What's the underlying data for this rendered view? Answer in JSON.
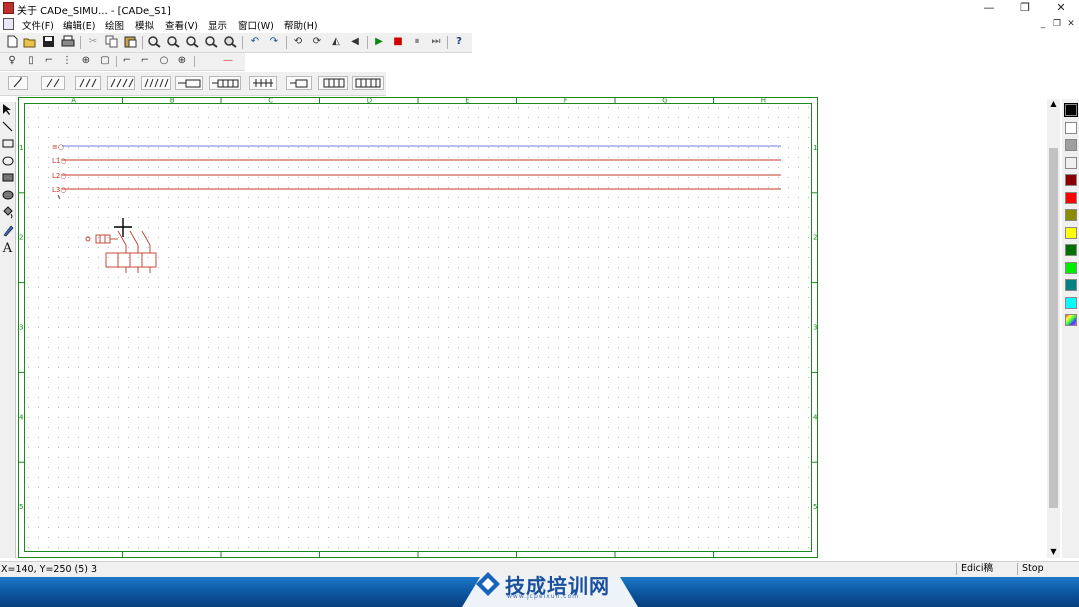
{
  "window": {
    "title": "关于 CADe_SIMU... - [CADe_S1]",
    "minimize_glyph": "—",
    "restore_glyph": "❐",
    "close_glyph": "✕"
  },
  "menu": {
    "items": [
      "文件(F)",
      "编辑(E)",
      "绘图",
      "模拟",
      "查看(V)",
      "显示",
      "窗口(W)",
      "帮助(H)"
    ],
    "mdi_minimize": "_",
    "mdi_restore": "❐",
    "mdi_close": "✕"
  },
  "toolbar_main": {
    "icons": [
      "new-file-icon",
      "open-folder-icon",
      "save-icon",
      "print-icon",
      "cut-icon",
      "copy-icon",
      "paste-icon",
      "zoom-in-icon",
      "zoom-out-icon",
      "zoom-window-icon",
      "zoom-all-icon",
      "pan-icon",
      "undo-icon",
      "redo-icon",
      "rotate-left-icon",
      "rotate-right-icon",
      "mirror-horizontal-icon",
      "mirror-vertical-icon",
      "play-icon",
      "stop-icon",
      "pause-icon",
      "step-icon",
      "help-icon"
    ]
  },
  "toolbar_components": {
    "line_glyph": "—"
  },
  "left_tools": [
    "pointer-icon",
    "line-icon",
    "rectangle-icon",
    "ellipse-icon",
    "filled-rectangle-icon",
    "filled-ellipse-icon",
    "fill-icon",
    "pen-icon",
    "text-icon"
  ],
  "left_tools_text_glyph": "A",
  "sheet": {
    "columns": [
      "A",
      "B",
      "C",
      "D",
      "E",
      "F",
      "G",
      "H"
    ],
    "rows": [
      "1",
      "2",
      "3",
      "4",
      "5"
    ],
    "bus_labels": [
      "≡○",
      "L1○",
      "L2○",
      "L3○"
    ],
    "bus_colors": [
      "#6f7fd8",
      "#c0392b",
      "#c0392b",
      "#c0392b"
    ],
    "border_color": "#1a8a1a"
  },
  "palette": {
    "colors": [
      "#000000",
      "#ffffff",
      "#a0a0a0",
      "#f0f0f0",
      "#8b0000",
      "#ff0000",
      "#8b8b00",
      "#ffff00",
      "#007000",
      "#00ee00",
      "#008080",
      "#00ffff",
      "rainbow"
    ]
  },
  "status": {
    "coords": "X=140, Y=250 (5) 3",
    "mode": "Edici稿",
    "sim_state": "Stop"
  },
  "banner": {
    "brand": "技成培训网",
    "url": "www.jcpeixun.com"
  }
}
